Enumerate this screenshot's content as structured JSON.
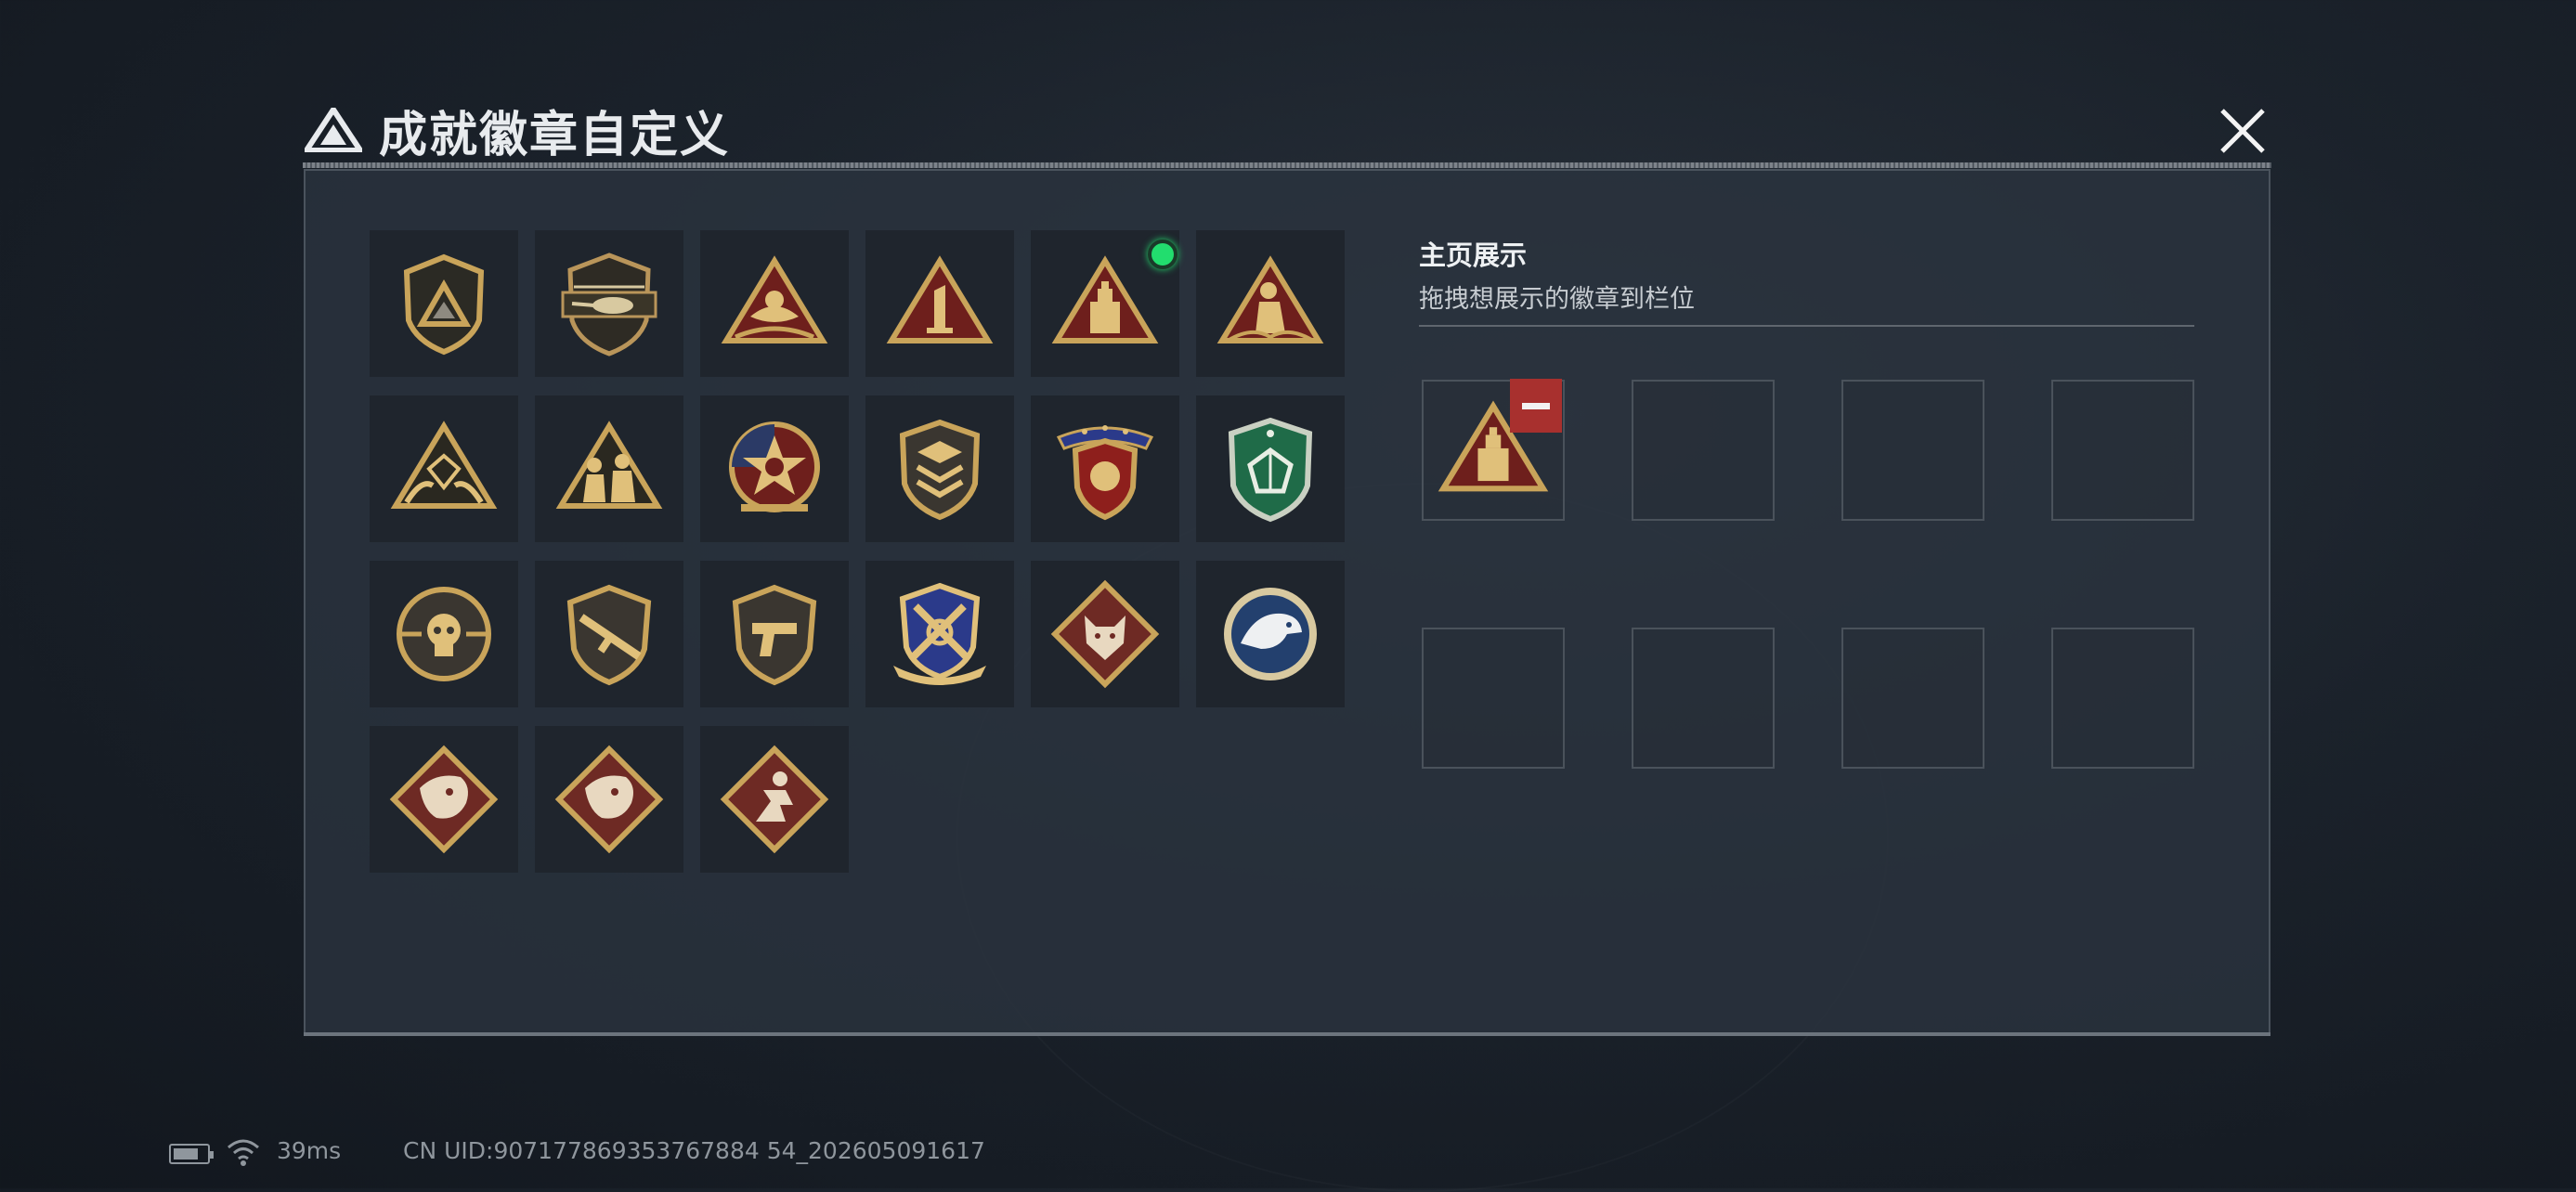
{
  "header": {
    "title": "成就徽章自定义",
    "logo_icon": "triangle-logo-icon",
    "close_icon": "close-icon"
  },
  "badges": [
    {
      "name": "shield-triangle-badge"
    },
    {
      "name": "helicopter-shield-badge"
    },
    {
      "name": "hands-triangle-badge"
    },
    {
      "name": "number-one-triangle-badge",
      "text": "1"
    },
    {
      "name": "bottle-triangle-badge",
      "new": true
    },
    {
      "name": "soldier-triangle-badge"
    },
    {
      "name": "gem-hands-triangle-badge"
    },
    {
      "name": "squad-triangle-badge"
    },
    {
      "name": "star-medal-badge"
    },
    {
      "name": "chevron-shield-badge"
    },
    {
      "name": "winged-stars-shield-badge"
    },
    {
      "name": "green-gem-shield-badge"
    },
    {
      "name": "skull-crosshair-badge"
    },
    {
      "name": "rifle-shield-badge"
    },
    {
      "name": "pistol-shield-badge"
    },
    {
      "name": "crossed-arms-ribbon-badge"
    },
    {
      "name": "wolf-diamond-badge"
    },
    {
      "name": "eagle-roundel-badge"
    },
    {
      "name": "dragon-diamond-badge"
    },
    {
      "name": "dragon-diamond-badge-2"
    },
    {
      "name": "runner-diamond-badge"
    }
  ],
  "showcase": {
    "title": "主页展示",
    "subtitle": "拖拽想展示的徽章到栏位",
    "slots": [
      "bottle-triangle-badge",
      "",
      "",
      "",
      "",
      "",
      "",
      ""
    ],
    "remove_icon": "minus-icon"
  },
  "status_bar": {
    "battery_icon": "battery-icon",
    "wifi_icon": "wifi-icon",
    "ping": "39ms",
    "uid": "CN UID:907177869353767884 54_202605091617"
  },
  "colors": {
    "gold": "#c9a45a",
    "dark_red": "#6e1f1c",
    "new_dot": "#22dd6e",
    "remove": "#a8302e"
  }
}
